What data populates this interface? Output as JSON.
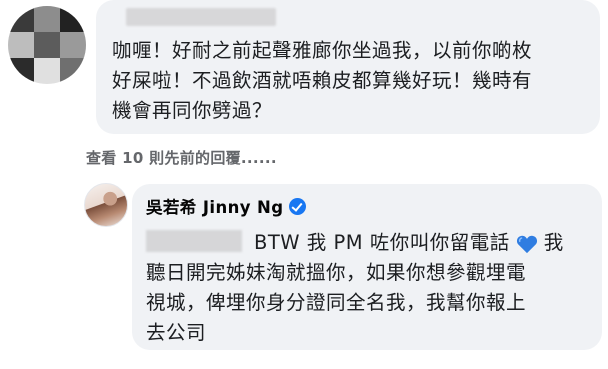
{
  "top_comment": {
    "text": "咖喱！好耐之前起聲雅廊你坐過我，以前你啲枚\n好屎啦！不過飲酒就唔賴皮都算幾好玩！幾時有\n機會再同你劈過？"
  },
  "view_previous": {
    "label": "查看 10 則先前的回覆......"
  },
  "reply": {
    "author": "吳若希 Jinny Ng",
    "first_line": "BTW 我 PM 咗你叫你留電話",
    "first_line_tail": "我",
    "rest": "聽日開完姊妹淘就搵你，如果你想參觀埋電\n視城，俾埋你身分證同全名我，我幫你報上\n去公司"
  },
  "icons": {
    "verified": "verified-badge-icon",
    "heart": "blue-heart-icon"
  },
  "colors": {
    "bubble": "#f0f2f5",
    "secondary_text": "#65676b",
    "verified_blue": "#1877f2",
    "heart_blue": "#2f7de1"
  }
}
